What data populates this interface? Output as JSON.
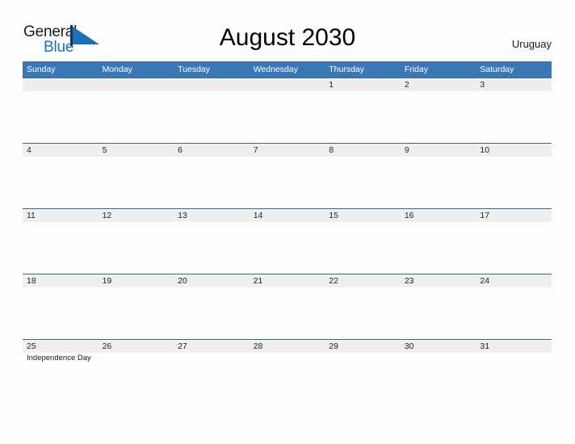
{
  "logo": {
    "word_one": "General",
    "word_two": "Blue",
    "mark_name": "blue-flag-triangle",
    "accent_color": "#1d70b8"
  },
  "header": {
    "title": "August 2030",
    "country": "Uruguay"
  },
  "theme": {
    "header_blue": "#3b77b5",
    "rule_blue": "#2e6da4",
    "band_gray": "#efefef",
    "page_background": "#fdfdfd",
    "text_dark": "#222222"
  },
  "calendar": {
    "month": "August",
    "year": "2030",
    "weekday_headers": [
      "Sunday",
      "Monday",
      "Tuesday",
      "Wednesday",
      "Thursday",
      "Friday",
      "Saturday"
    ],
    "weeks": [
      {
        "days": [
          {
            "number": "",
            "events": []
          },
          {
            "number": "",
            "events": []
          },
          {
            "number": "",
            "events": []
          },
          {
            "number": "",
            "events": []
          },
          {
            "number": "1",
            "events": []
          },
          {
            "number": "2",
            "events": []
          },
          {
            "number": "3",
            "events": []
          }
        ]
      },
      {
        "days": [
          {
            "number": "4",
            "events": []
          },
          {
            "number": "5",
            "events": []
          },
          {
            "number": "6",
            "events": []
          },
          {
            "number": "7",
            "events": []
          },
          {
            "number": "8",
            "events": []
          },
          {
            "number": "9",
            "events": []
          },
          {
            "number": "10",
            "events": []
          }
        ]
      },
      {
        "days": [
          {
            "number": "11",
            "events": []
          },
          {
            "number": "12",
            "events": []
          },
          {
            "number": "13",
            "events": []
          },
          {
            "number": "14",
            "events": []
          },
          {
            "number": "15",
            "events": []
          },
          {
            "number": "16",
            "events": []
          },
          {
            "number": "17",
            "events": []
          }
        ]
      },
      {
        "days": [
          {
            "number": "18",
            "events": []
          },
          {
            "number": "19",
            "events": []
          },
          {
            "number": "20",
            "events": []
          },
          {
            "number": "21",
            "events": []
          },
          {
            "number": "22",
            "events": []
          },
          {
            "number": "23",
            "events": []
          },
          {
            "number": "24",
            "events": []
          }
        ]
      },
      {
        "days": [
          {
            "number": "25",
            "events": [
              "Independence Day"
            ]
          },
          {
            "number": "26",
            "events": []
          },
          {
            "number": "27",
            "events": []
          },
          {
            "number": "28",
            "events": []
          },
          {
            "number": "29",
            "events": []
          },
          {
            "number": "30",
            "events": []
          },
          {
            "number": "31",
            "events": []
          }
        ]
      }
    ]
  }
}
